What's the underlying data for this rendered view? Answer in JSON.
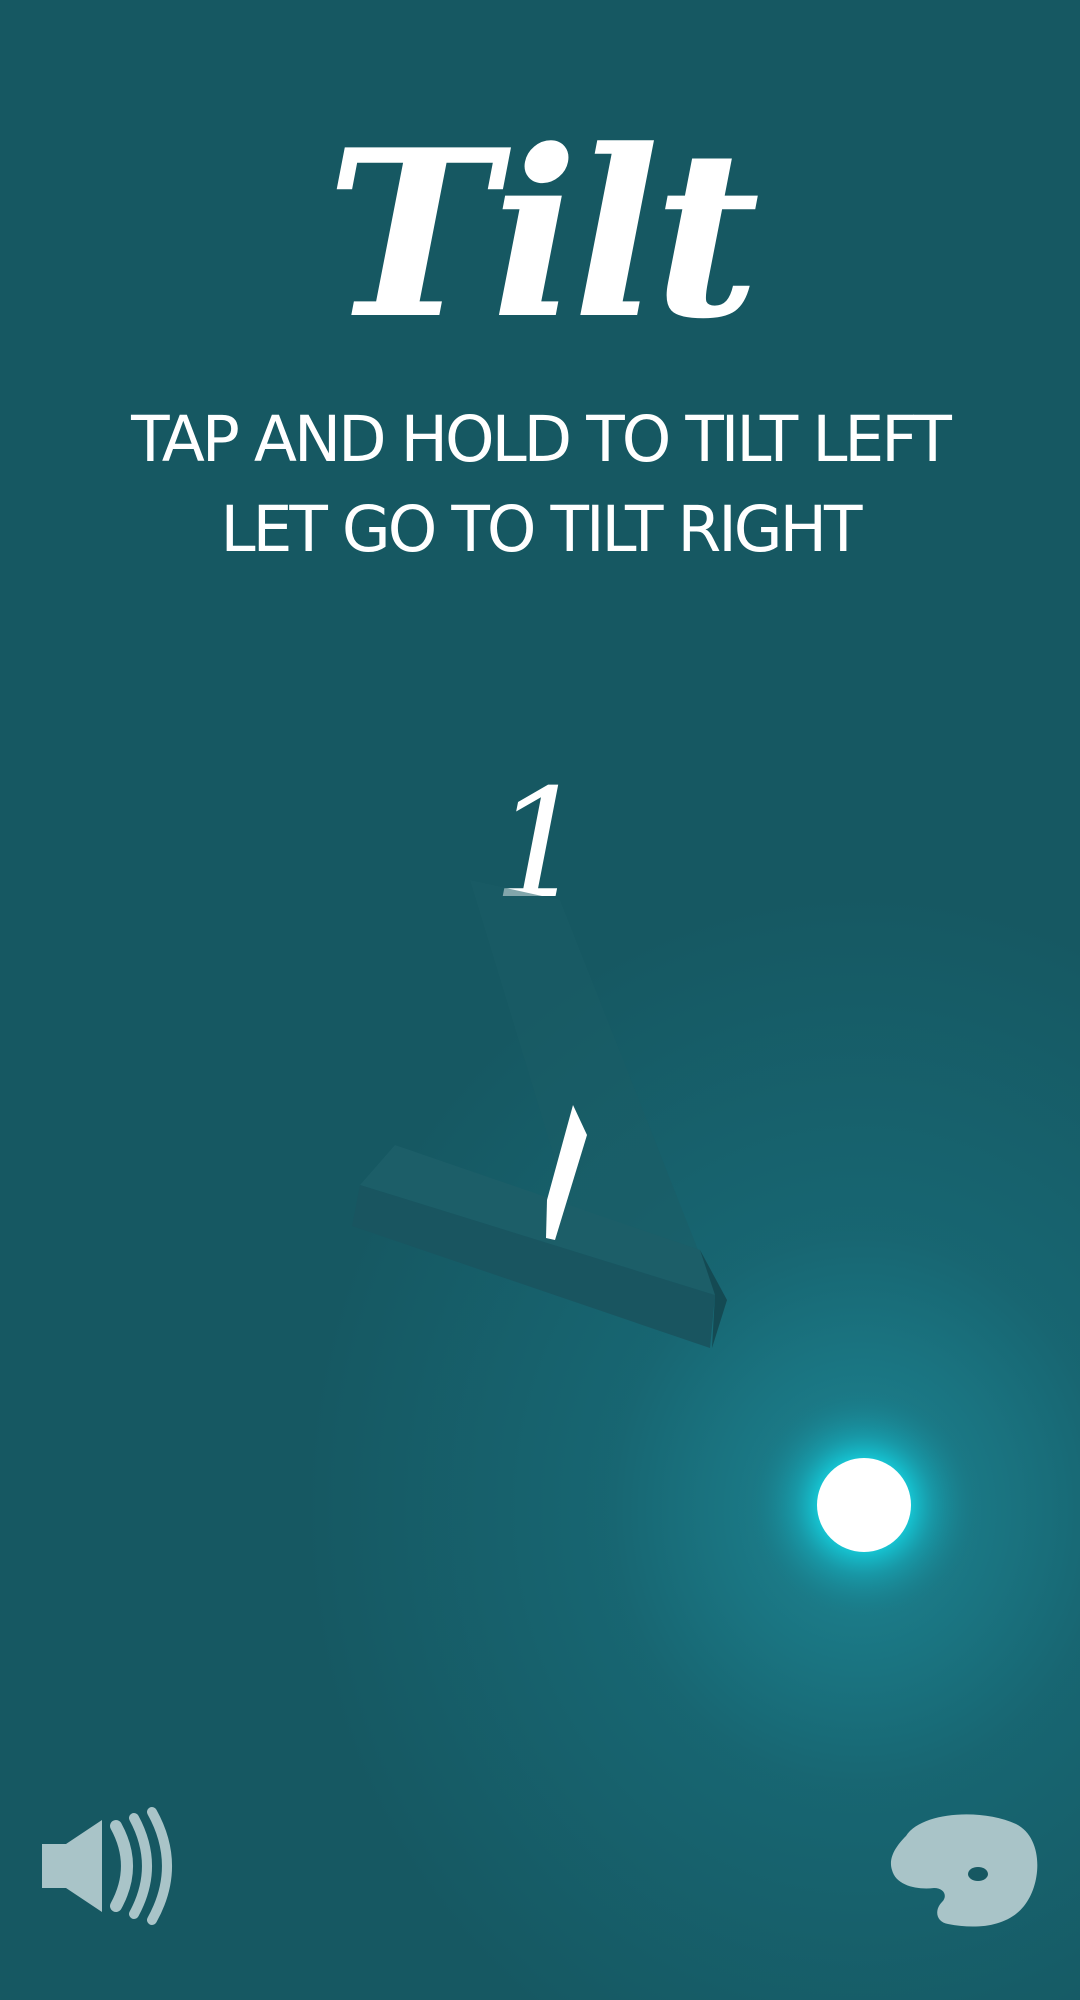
{
  "game": {
    "title": "Tilt",
    "instructions": {
      "line1": "TAP AND HOLD TO TILT LEFT",
      "line2": "LET GO TO TILT RIGHT"
    },
    "score": "1"
  },
  "controls": {
    "sound_icon": "speaker-sound-on-icon",
    "palette_icon": "paint-palette-icon"
  },
  "colors": {
    "background": "#165862",
    "ball": "#ffffff",
    "ball_glow": "#14e8f5",
    "icon_tint": "#a9c4c8"
  }
}
